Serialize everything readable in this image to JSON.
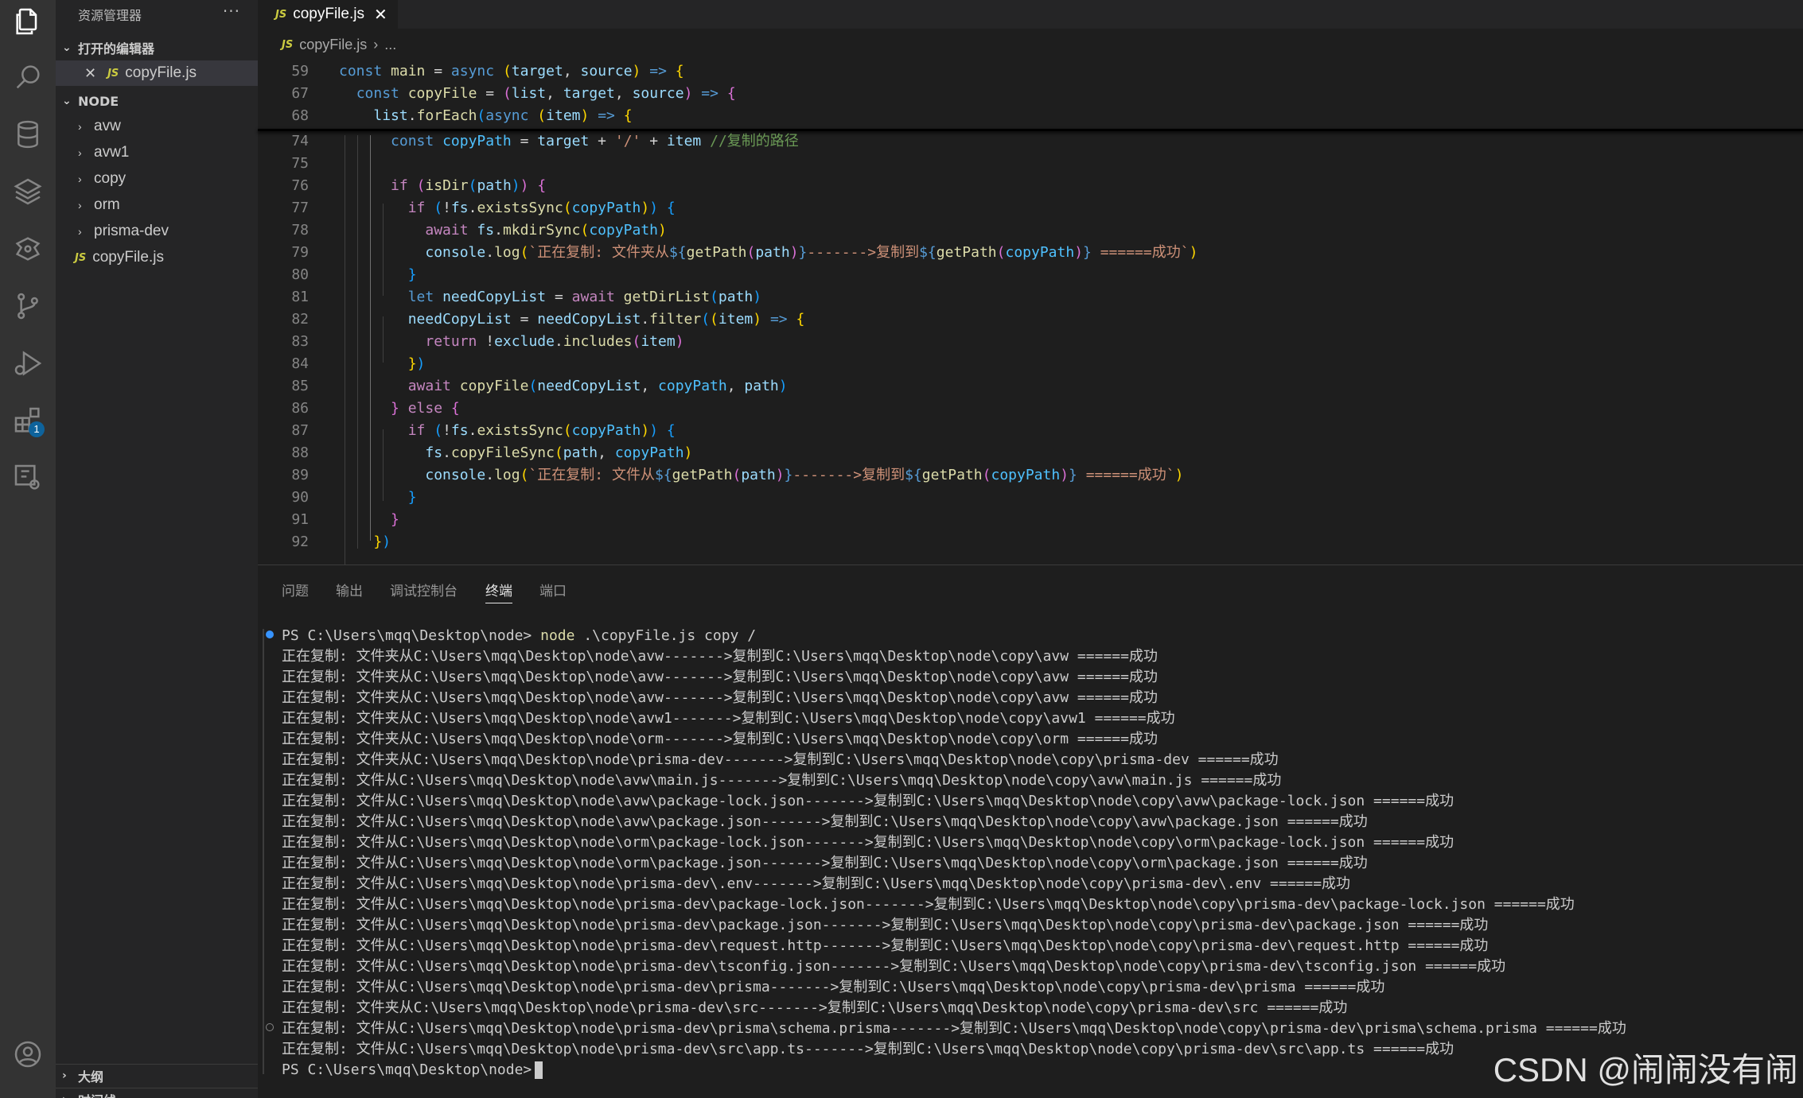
{
  "activity_bar": {
    "icons": [
      "explorer-icon",
      "search-icon",
      "database-icon",
      "layers-icon",
      "extensions-alt-icon",
      "source-control-icon",
      "run-debug-icon",
      "extensions-icon",
      "remote-icon",
      "account-icon"
    ],
    "extensions_badge": "1"
  },
  "sidebar": {
    "title": "资源管理器",
    "more": "···",
    "open_editors_title": "打开的编辑器",
    "open_editor_file": "copyFile.js",
    "folder_title": "NODE",
    "items": [
      {
        "label": "avw",
        "type": "folder"
      },
      {
        "label": "avw1",
        "type": "folder"
      },
      {
        "label": "copy",
        "type": "folder"
      },
      {
        "label": "orm",
        "type": "folder"
      },
      {
        "label": "prisma-dev",
        "type": "folder"
      },
      {
        "label": "copyFile.js",
        "type": "file"
      }
    ],
    "outline_title": "大纲",
    "timeline_title": "时间线"
  },
  "editor": {
    "tab_label": "copyFile.js",
    "tab_close": "✕",
    "js_badge": "JS",
    "breadcrumb_file": "copyFile.js",
    "breadcrumb_rest": "...",
    "line_numbers": [
      "59",
      "67",
      "68",
      "74",
      "75",
      "76",
      "77",
      "78",
      "79",
      "80",
      "81",
      "82",
      "83",
      "84",
      "85",
      "86",
      "87",
      "88",
      "89",
      "90",
      "91",
      "92"
    ]
  },
  "panel": {
    "tabs": [
      "问题",
      "输出",
      "调试控制台",
      "终端",
      "端口"
    ],
    "active_tab": "终端",
    "prompt": "PS C:\\Users\\mqq\\Desktop\\node>",
    "command_node": "node",
    "command_args": " .\\copyFile.js copy /",
    "output": [
      "正在复制: 文件夹从C:\\Users\\mqq\\Desktop\\node\\avw------->复制到C:\\Users\\mqq\\Desktop\\node\\copy\\avw ======成功",
      "正在复制: 文件夹从C:\\Users\\mqq\\Desktop\\node\\avw------->复制到C:\\Users\\mqq\\Desktop\\node\\copy\\avw ======成功",
      "正在复制: 文件夹从C:\\Users\\mqq\\Desktop\\node\\avw------->复制到C:\\Users\\mqq\\Desktop\\node\\copy\\avw ======成功",
      "正在复制: 文件夹从C:\\Users\\mqq\\Desktop\\node\\avw1------->复制到C:\\Users\\mqq\\Desktop\\node\\copy\\avw1 ======成功",
      "正在复制: 文件夹从C:\\Users\\mqq\\Desktop\\node\\orm------->复制到C:\\Users\\mqq\\Desktop\\node\\copy\\orm ======成功",
      "正在复制: 文件夹从C:\\Users\\mqq\\Desktop\\node\\prisma-dev------->复制到C:\\Users\\mqq\\Desktop\\node\\copy\\prisma-dev ======成功",
      "正在复制: 文件从C:\\Users\\mqq\\Desktop\\node\\avw\\main.js------->复制到C:\\Users\\mqq\\Desktop\\node\\copy\\avw\\main.js ======成功",
      "正在复制: 文件从C:\\Users\\mqq\\Desktop\\node\\avw\\package-lock.json------->复制到C:\\Users\\mqq\\Desktop\\node\\copy\\avw\\package-lock.json ======成功",
      "正在复制: 文件从C:\\Users\\mqq\\Desktop\\node\\avw\\package.json------->复制到C:\\Users\\mqq\\Desktop\\node\\copy\\avw\\package.json ======成功",
      "正在复制: 文件从C:\\Users\\mqq\\Desktop\\node\\orm\\package-lock.json------->复制到C:\\Users\\mqq\\Desktop\\node\\copy\\orm\\package-lock.json ======成功",
      "正在复制: 文件从C:\\Users\\mqq\\Desktop\\node\\orm\\package.json------->复制到C:\\Users\\mqq\\Desktop\\node\\copy\\orm\\package.json ======成功",
      "正在复制: 文件从C:\\Users\\mqq\\Desktop\\node\\prisma-dev\\.env------->复制到C:\\Users\\mqq\\Desktop\\node\\copy\\prisma-dev\\.env ======成功",
      "正在复制: 文件从C:\\Users\\mqq\\Desktop\\node\\prisma-dev\\package-lock.json------->复制到C:\\Users\\mqq\\Desktop\\node\\copy\\prisma-dev\\package-lock.json ======成功",
      "正在复制: 文件从C:\\Users\\mqq\\Desktop\\node\\prisma-dev\\package.json------->复制到C:\\Users\\mqq\\Desktop\\node\\copy\\prisma-dev\\package.json ======成功",
      "正在复制: 文件从C:\\Users\\mqq\\Desktop\\node\\prisma-dev\\request.http------->复制到C:\\Users\\mqq\\Desktop\\node\\copy\\prisma-dev\\request.http ======成功",
      "正在复制: 文件从C:\\Users\\mqq\\Desktop\\node\\prisma-dev\\tsconfig.json------->复制到C:\\Users\\mqq\\Desktop\\node\\copy\\prisma-dev\\tsconfig.json ======成功",
      "正在复制: 文件从C:\\Users\\mqq\\Desktop\\node\\prisma-dev\\prisma------->复制到C:\\Users\\mqq\\Desktop\\node\\copy\\prisma-dev\\prisma ======成功",
      "正在复制: 文件夹从C:\\Users\\mqq\\Desktop\\node\\prisma-dev\\src------->复制到C:\\Users\\mqq\\Desktop\\node\\copy\\prisma-dev\\src ======成功",
      "正在复制: 文件从C:\\Users\\mqq\\Desktop\\node\\prisma-dev\\prisma\\schema.prisma------->复制到C:\\Users\\mqq\\Desktop\\node\\copy\\prisma-dev\\prisma\\schema.prisma ======成功",
      "正在复制: 文件从C:\\Users\\mqq\\Desktop\\node\\prisma-dev\\src\\app.ts------->复制到C:\\Users\\mqq\\Desktop\\node\\copy\\prisma-dev\\src\\app.ts ======成功"
    ],
    "final_prompt": "PS C:\\Users\\mqq\\Desktop\\node>"
  },
  "watermark": "CSDN @闹闹没有闹",
  "colors": {
    "activity_bg": "#333333",
    "sidebar_bg": "#252526",
    "editor_bg": "#1e1e1e",
    "js_yellow": "#cbcb41",
    "accent_blue": "#0e639c"
  }
}
